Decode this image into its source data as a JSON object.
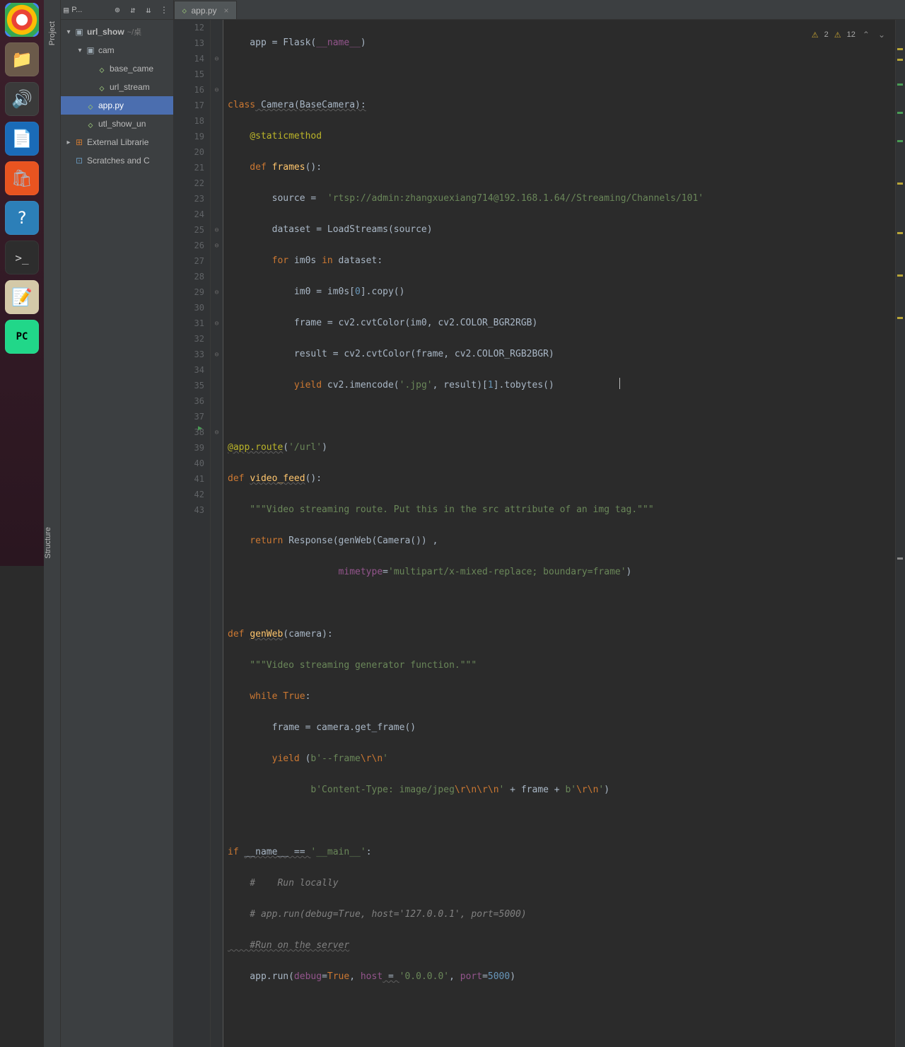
{
  "launcher": {
    "items": [
      "chrome",
      "files",
      "media",
      "office-writer",
      "software",
      "help",
      "terminal",
      "gedit",
      "pycharm"
    ]
  },
  "sidebar_tabs": {
    "top": "Project",
    "bottom": "Structure"
  },
  "project_panel": {
    "header_label": "P...",
    "root": {
      "name": "url_show",
      "path": "~/桌"
    },
    "cam_folder": "cam",
    "files": {
      "base_camera": "base_came",
      "url_stream": "url_stream",
      "app": "app.py",
      "utl_show": "utl_show_un"
    },
    "external": "External Librarie",
    "scratches": "Scratches and C"
  },
  "tab": {
    "label": "app.py"
  },
  "inspections": {
    "warn1": "2",
    "warn2": "12"
  },
  "line_numbers": [
    "12",
    "13",
    "14",
    "15",
    "16",
    "17",
    "18",
    "19",
    "20",
    "21",
    "22",
    "23",
    "24",
    "25",
    "26",
    "27",
    "28",
    "29",
    "30",
    "31",
    "32",
    "33",
    "34",
    "35",
    "36",
    "37",
    "38",
    "39",
    "40",
    "41",
    "42",
    "43"
  ],
  "code": {
    "l12a": "    app = Flask(",
    "l12b": "__name__",
    "l12c": ")",
    "l14a": "class",
    "l14b": " Camera(BaseCamera):",
    "l15a": "    @staticmethod",
    "l16a": "    def ",
    "l16b": "frames",
    "l16c": "():",
    "l17a": "        source =  ",
    "l17b": "'rtsp://admin:zhangxuexiang714@192.168.1.64//Streaming/Channels/101'",
    "l18a": "        dataset = LoadStreams(source)",
    "l19a": "        for ",
    "l19b": "im0s ",
    "l19c": "in ",
    "l19d": "dataset:",
    "l20a": "            im0 = im0s[",
    "l20b": "0",
    "l20c": "].copy()",
    "l21a": "            frame = cv2.cvtColor(im0, cv2.COLOR_BGR2RGB)",
    "l22a": "            result = cv2.cvtColor(frame, cv2.COLOR_RGB2BGR)",
    "l23a": "            yield ",
    "l23b": "cv2.imencode(",
    "l23c": "'.jpg'",
    "l23d": ", result)[",
    "l23e": "1",
    "l23f": "].tobytes()",
    "l25a": "@app.route",
    "l25b": "(",
    "l25c": "'/url'",
    "l25d": ")",
    "l26a": "def ",
    "l26b": "video_feed",
    "l26c": "():",
    "l27a": "    \"\"\"Video streaming route. Put this in the src attribute of an img tag.\"\"\"",
    "l28a": "    return ",
    "l28b": "Response(genWeb(Camera()) ,",
    "l29a": "                    ",
    "l29b": "mimetype",
    "l29c": "=",
    "l29d": "'multipart/x-mixed-replace; boundary=frame'",
    "l29e": ")",
    "l31a": "def ",
    "l31b": "genWeb",
    "l31c": "(camera):",
    "l32a": "    \"\"\"Video streaming generator function.\"\"\"",
    "l33a": "    while ",
    "l33b": "True",
    "l33c": ":",
    "l34a": "        frame = camera.get_frame()",
    "l35a": "        yield ",
    "l35b": "(",
    "l35c": "b'--frame",
    "l35d": "\\r\\n",
    "l35e": "'",
    "l36a": "               ",
    "l36b": "b'Content-Type: image/jpeg",
    "l36c": "\\r\\n\\r\\n",
    "l36d": "'",
    "l36e": " + frame + ",
    "l36f": "b'",
    "l36g": "\\r\\n",
    "l36h": "'",
    "l36i": ")",
    "l38a": "if ",
    "l38b": "__name__ == ",
    "l38c": "'__main__'",
    "l38d": ":",
    "l39a": "    #    Run locally",
    "l40a": "    # app.run(debug=True, host='127.0.0.1', port=5000)",
    "l41a": "    #Run on the server",
    "l42a": "    app.run(",
    "l42b": "debug",
    "l42c": "=",
    "l42d": "True",
    "l42e": ", ",
    "l42f": "host",
    "l42g": " = ",
    "l42h": "'0.0.0.0'",
    "l42i": ", ",
    "l42j": "port",
    "l42k": "=",
    "l42l": "5000",
    "l42m": ")"
  }
}
